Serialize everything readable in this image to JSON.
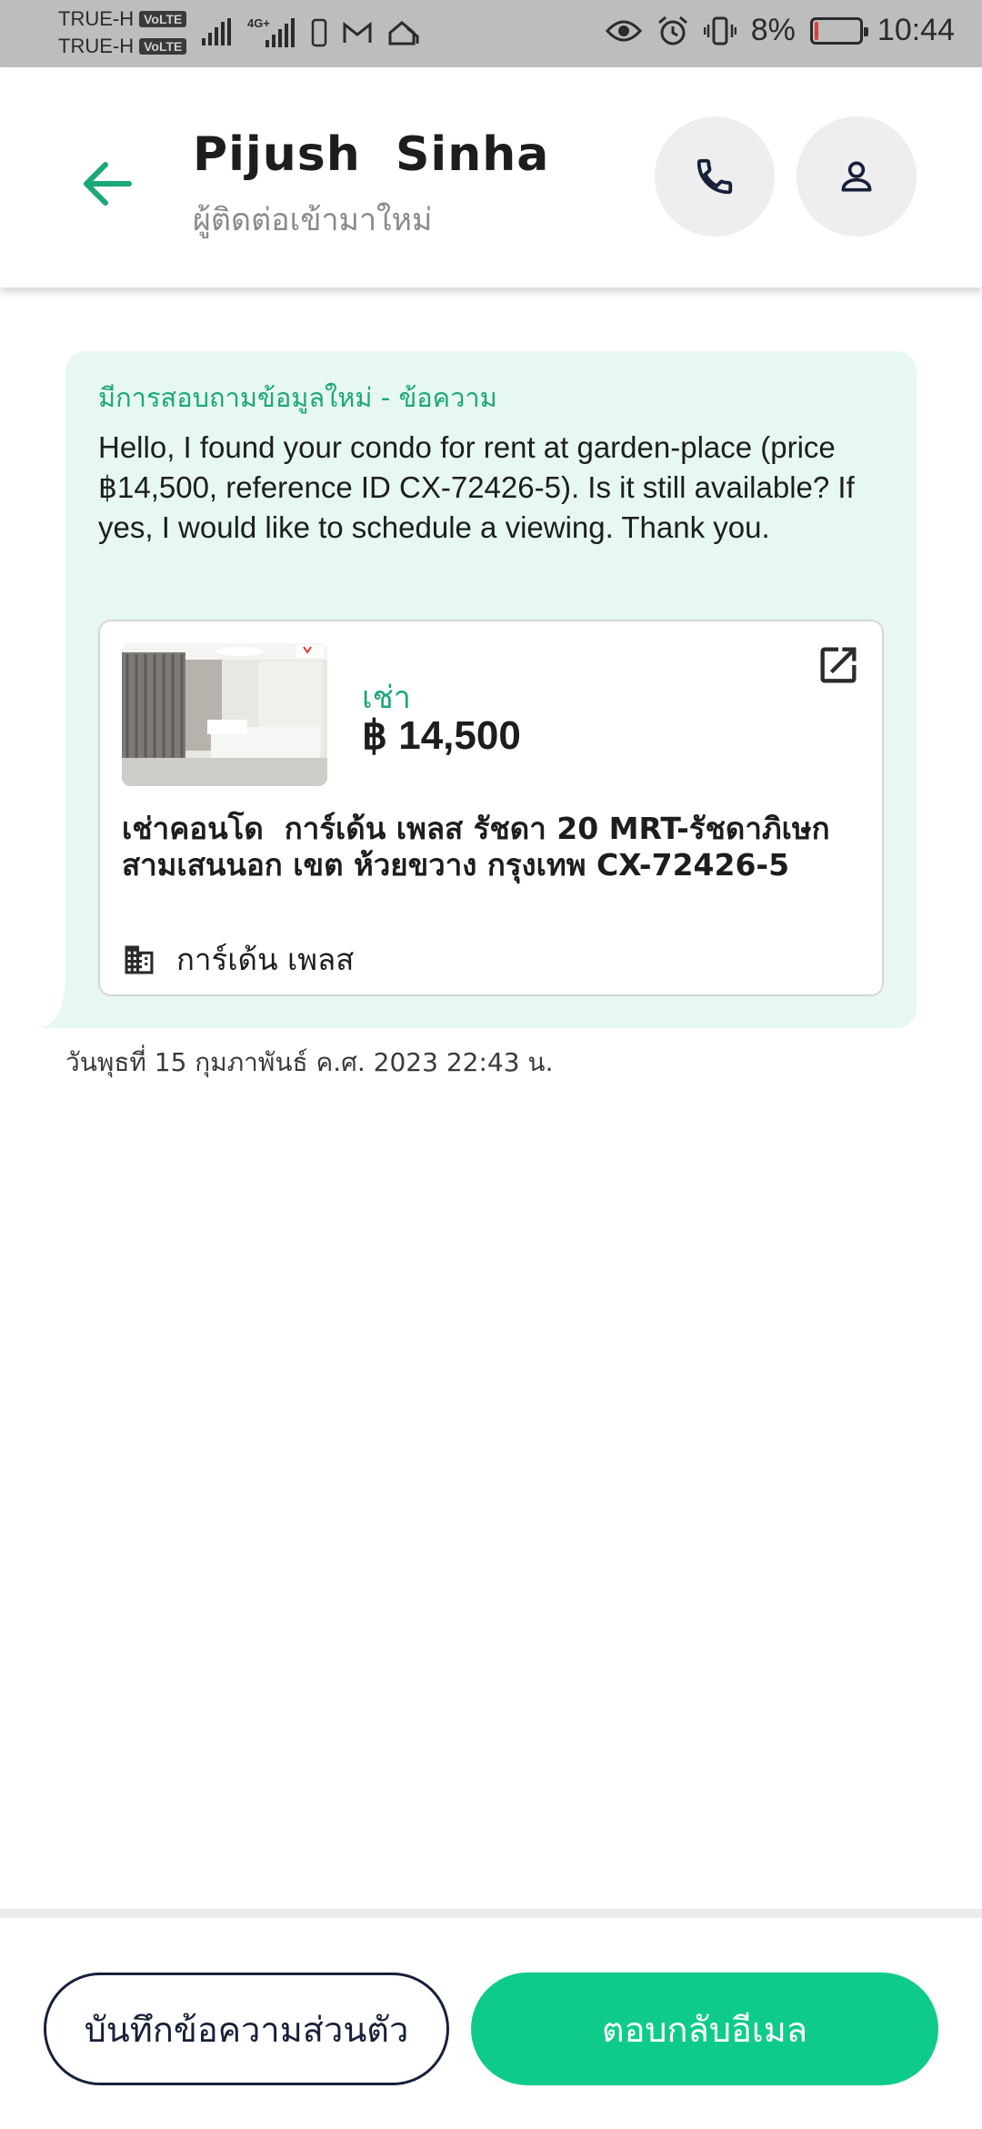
{
  "status_bar": {
    "carrier_1": "TRUE-H",
    "carrier_2": "TRUE-H",
    "volte_badge": "VoLTE",
    "network_type": "4G+",
    "battery_percent": "8%",
    "battery_level": 0.08,
    "time": "10:44",
    "icons": [
      "signal-icon",
      "signal-4g-icon",
      "vibrate-phone-icon",
      "gmail-icon",
      "home-icon",
      "eye-icon",
      "alarm-icon",
      "vibrate-icon",
      "battery-icon"
    ]
  },
  "header": {
    "contact_name": "Pijush  Sinha",
    "contact_status": "ผู้ติดต่อเข้ามาใหม่",
    "accent_color": "#1aa877"
  },
  "message": {
    "label": "มีการสอบถามข้อมูลใหม่ - ข้อความ",
    "text": "Hello, I found your condo for rent at garden-place (price ฿14,500, reference ID CX-72426-5). Is it still available? If yes, I would like to schedule a viewing. Thank you.",
    "timestamp": "วันพุธที่ 15 กุมภาพันธ์ ค.ศ. 2023 22:43 น.",
    "bubble_color": "#e7f7f1"
  },
  "listing": {
    "type": "เช่า",
    "price": "฿ 14,500",
    "title": "เช่าคอนโด  การ์เด้น เพลส รัชดา 20 MRT-รัชดาภิเษก สามเสนนอก เขต ห้วยขวาง กรุงเทพ CX-72426-5",
    "project": "การ์เด้น เพลส"
  },
  "actions": {
    "note_label": "บันทึกข้อความส่วนตัว",
    "reply_label": "ตอบกลับอีเมล",
    "primary_color": "#0fcb8a"
  }
}
